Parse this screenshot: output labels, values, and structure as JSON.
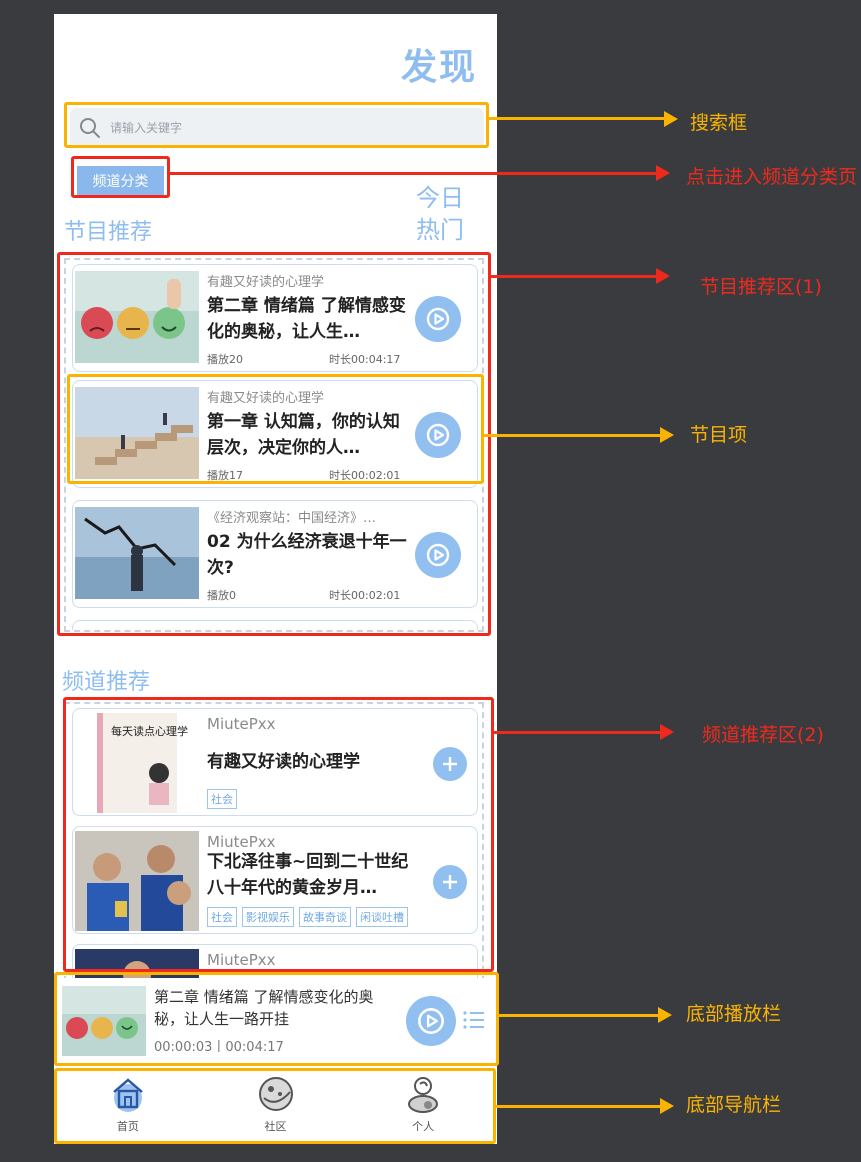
{
  "header": {
    "title": "发现"
  },
  "search": {
    "placeholder": "请输入关键字"
  },
  "channel_button": {
    "label": "频道分类"
  },
  "sections": {
    "programs": "节目推荐",
    "hot": "今日热门",
    "channels": "频道推荐"
  },
  "programs": [
    {
      "channel": "有趣又好读的心理学",
      "title": "第二章 情绪篇 了解情感变化的奥秘，让人生…",
      "plays": "播放20",
      "duration": "时长00:04:17"
    },
    {
      "channel": "有趣又好读的心理学",
      "title": "第一章 认知篇，你的认知层次，决定你的人…",
      "plays": "播放17",
      "duration": "时长00:02:01"
    },
    {
      "channel": "《经济观察站：中国经济》…",
      "title": "02 为什么经济衰退十年一次?",
      "plays": "播放0",
      "duration": "时长00:02:01"
    }
  ],
  "channels": [
    {
      "author": "MiutePxx",
      "title": "有趣又好读的心理学",
      "tags": [
        "社会"
      ]
    },
    {
      "author": "MiutePxx",
      "title": "下北泽往事~回到二十世纪八十年代的黄金岁月…",
      "tags": [
        "社会",
        "影视娱乐",
        "故事奇谈",
        "闲谈吐槽"
      ]
    },
    {
      "author": "MiutePxx",
      "title": "",
      "tags": []
    }
  ],
  "player": {
    "title": "第二章 情绪篇 了解情感变化的奥秘，让人生一路开挂",
    "time": "00:00:03丨00:04:17"
  },
  "tabbar": [
    {
      "label": "首页",
      "icon": "home-icon"
    },
    {
      "label": "社区",
      "icon": "community-icon"
    },
    {
      "label": "个人",
      "icon": "profile-icon"
    }
  ],
  "book_cover": {
    "title": "每天读点心理学"
  },
  "annotations": {
    "search": "搜索框",
    "channel_category": "点击进入频道分类页",
    "program_area": "节目推荐区(1)",
    "program_item": "节目项",
    "channel_area": "频道推荐区(2)",
    "player_bar": "底部播放栏",
    "nav_bar": "底部导航栏"
  },
  "colors": {
    "accent": "#8fbdf0",
    "annotation_yellow": "#f9b300",
    "annotation_red": "#ef2a1c",
    "background": "#3a3b3f"
  }
}
